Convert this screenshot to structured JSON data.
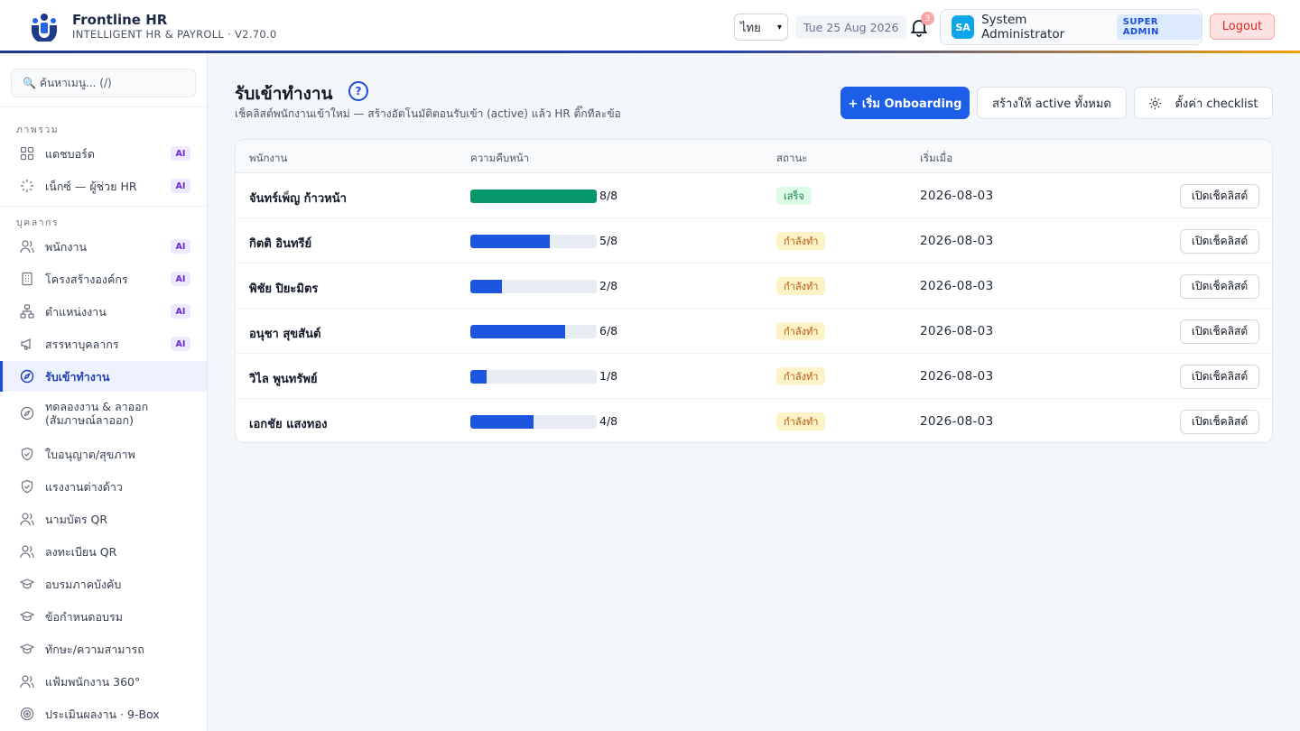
{
  "header": {
    "app_name": "Frontline HR",
    "app_subtitle": "INTELLIGENT HR & PAYROLL · V2.70.0",
    "language": "ไทย",
    "date": "Tue 25 Aug 2026",
    "notification_count": "3",
    "user_initials": "SA",
    "user_name": "System Administrator",
    "user_role": "SUPER ADMIN",
    "logout_label": "Logout"
  },
  "sidebar": {
    "search_placeholder": "ค้นหาเมนู... (/)",
    "sections": [
      {
        "label": "ภาพรวม"
      },
      {
        "label": "บุคลากร"
      }
    ],
    "items": [
      {
        "label": "แดชบอร์ด",
        "icon": "grid-icon",
        "ai": "AI"
      },
      {
        "label": "เน็กซ์ — ผู้ช่วย HR",
        "icon": "sparkle-icon",
        "ai": "AI"
      },
      {
        "label": "พนักงาน",
        "icon": "users-icon",
        "ai": "AI"
      },
      {
        "label": "โครงสร้างองค์กร",
        "icon": "building-icon",
        "ai": "AI"
      },
      {
        "label": "ตำแหน่งงาน",
        "icon": "hierarchy-icon",
        "ai": "AI"
      },
      {
        "label": "สรรหาบุคลากร",
        "icon": "megaphone-icon",
        "ai": "AI"
      },
      {
        "label": "รับเข้าทำงาน",
        "icon": "compass-icon"
      },
      {
        "label": "ทดลองงาน & ลาออก",
        "label2": "(สัมภาษณ์ลาออก)",
        "icon": "compass-icon"
      },
      {
        "label": "ใบอนุญาต/สุขภาพ",
        "icon": "shield-check-icon"
      },
      {
        "label": "แรงงานต่างด้าว",
        "icon": "shield-check-icon"
      },
      {
        "label": "นามบัตร QR",
        "icon": "users-icon"
      },
      {
        "label": "ลงทะเบียน QR",
        "icon": "users-icon"
      },
      {
        "label": "อบรมภาคบังคับ",
        "icon": "graduation-cap-icon"
      },
      {
        "label": "ข้อกำหนดอบรม",
        "icon": "graduation-cap-icon"
      },
      {
        "label": "ทักษะ/ความสามารถ",
        "icon": "graduation-cap-icon"
      },
      {
        "label": "แฟ้มพนักงาน 360°",
        "icon": "users-icon"
      },
      {
        "label": "ประเมินผลงาน · 9-Box",
        "icon": "target-icon"
      }
    ]
  },
  "main": {
    "title": "รับเข้าทำงาน",
    "help": "?",
    "subtitle": "เช็คลิสต์พนักงานเข้าใหม่ — สร้างอัตโนมัติตอนรับเข้า (active) แล้ว HR ติ๊กทีละข้อ",
    "start_button": "+ เริ่ม Onboarding",
    "activate_all_button": "สร้างให้ active ทั้งหมด",
    "config_button": "ตั้งค่า checklist",
    "columns": [
      "พนักงาน",
      "ความคืบหน้า",
      "สถานะ",
      "เริ่มเมื่อ"
    ],
    "rows": [
      {
        "name": "จันทร์เพ็ญ ก้าวหน้า",
        "done": 8,
        "total": 8,
        "progress_label": "8/8",
        "status": "เสร็จ",
        "status_kind": "done",
        "start_date": "2026-08-03",
        "action": "เปิดเช็คลิสต์"
      },
      {
        "name": "กิตติ อินทรีย์",
        "done": 5,
        "total": 8,
        "progress_label": "5/8",
        "status": "กำลังทำ",
        "status_kind": "progress",
        "start_date": "2026-08-03",
        "action": "เปิดเช็คลิสต์"
      },
      {
        "name": "พิชัย ปิยะมิตร",
        "done": 2,
        "total": 8,
        "progress_label": "2/8",
        "status": "กำลังทำ",
        "status_kind": "progress",
        "start_date": "2026-08-03",
        "action": "เปิดเช็คลิสต์"
      },
      {
        "name": "อนุชา สุขสันต์",
        "done": 6,
        "total": 8,
        "progress_label": "6/8",
        "status": "กำลังทำ",
        "status_kind": "progress",
        "start_date": "2026-08-03",
        "action": "เปิดเช็คลิสต์"
      },
      {
        "name": "วิไล พูนทรัพย์",
        "done": 1,
        "total": 8,
        "progress_label": "1/8",
        "status": "กำลังทำ",
        "status_kind": "progress",
        "start_date": "2026-08-03",
        "action": "เปิดเช็คลิสต์"
      },
      {
        "name": "เอกชัย แสงทอง",
        "done": 4,
        "total": 8,
        "progress_label": "4/8",
        "status": "กำลังทำ",
        "status_kind": "progress",
        "start_date": "2026-08-03",
        "action": "เปิดเช็คลิสต์"
      }
    ]
  },
  "colors": {
    "primary": "#1d5ee8",
    "progress_bar": "#1d56de",
    "progress_done": "#059669",
    "ai_badge": "#6d28d9"
  }
}
